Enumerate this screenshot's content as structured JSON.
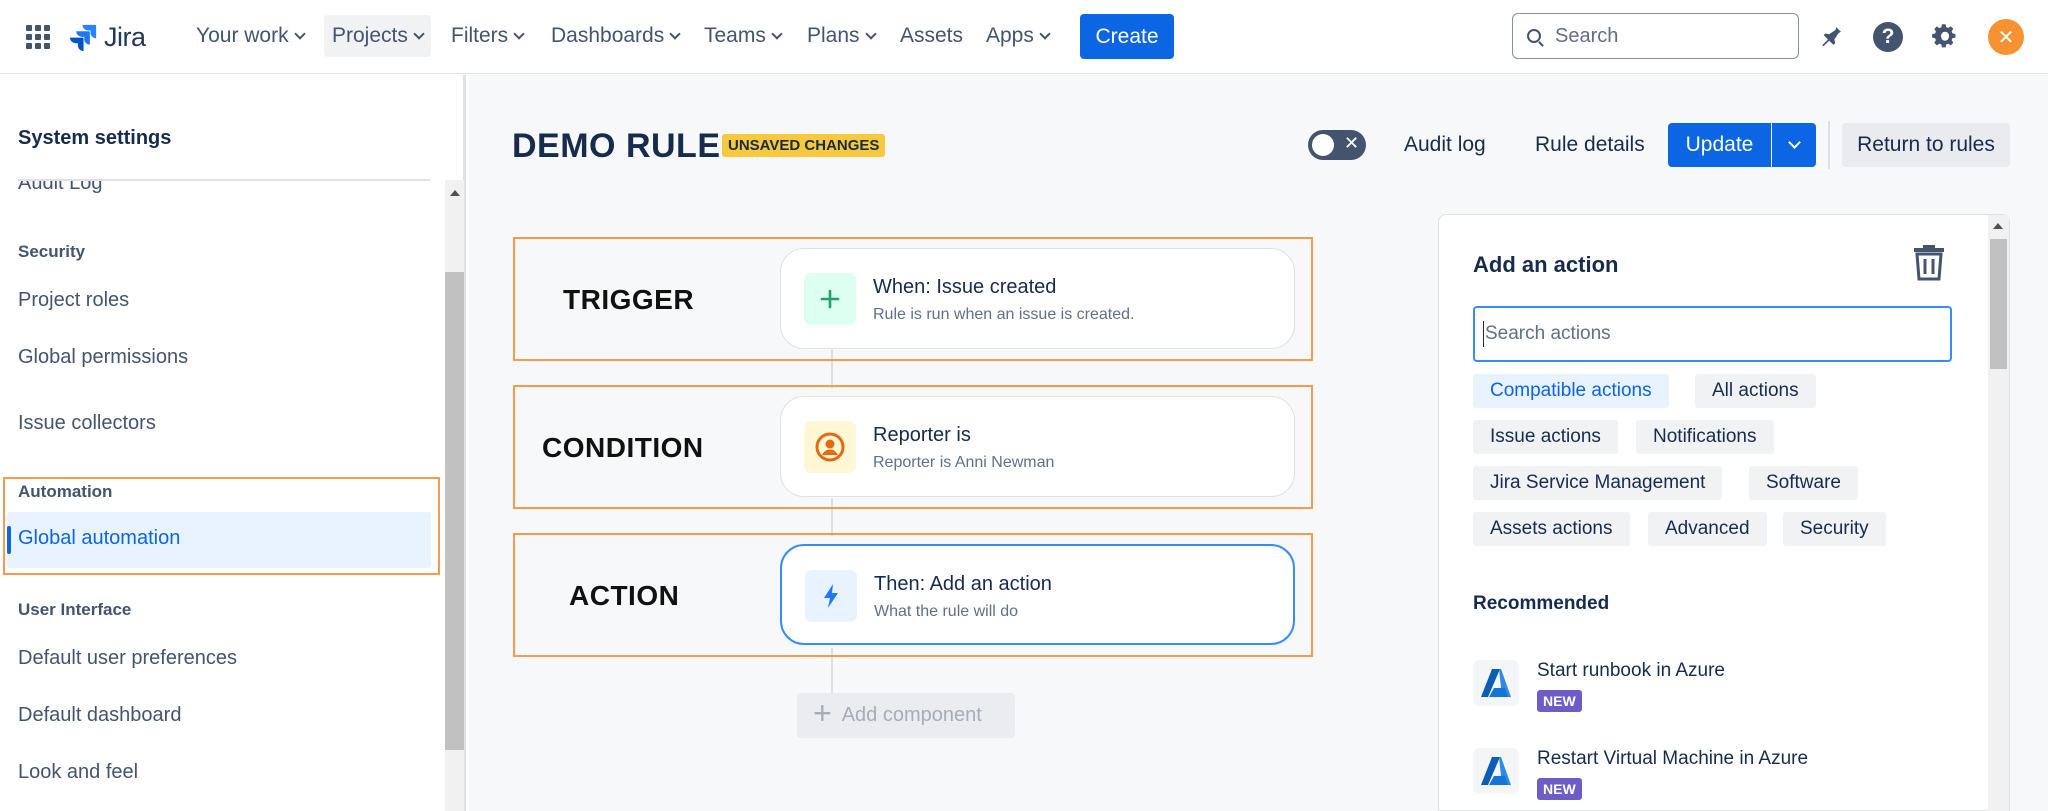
{
  "nav": {
    "brand": "Jira",
    "items": [
      "Your work",
      "Projects",
      "Filters",
      "Dashboards",
      "Teams",
      "Plans",
      "Assets",
      "Apps"
    ],
    "create_label": "Create",
    "search_placeholder": "Search"
  },
  "sidebar": {
    "title": "System settings",
    "partial_item": "Audit Log",
    "security_heading": "Security",
    "security_items": [
      "Project roles",
      "Global permissions",
      "Issue collectors"
    ],
    "automation_heading": "Automation",
    "automation_selected": "Global automation",
    "ui_heading": "User Interface",
    "ui_items": [
      "Default user preferences",
      "Default dashboard",
      "Look and feel"
    ]
  },
  "header": {
    "rule_title": "DEMO RULE",
    "unsaved_badge": "UNSAVED CHANGES",
    "toggle_symbol": "✕",
    "audit_log": "Audit log",
    "rule_details": "Rule details",
    "update_label": "Update",
    "return_label": "Return to rules"
  },
  "rule": {
    "labels": [
      "TRIGGER",
      "CONDITION",
      "ACTION"
    ],
    "trigger": {
      "title": "When: Issue created",
      "subtitle": "Rule is run when an issue is created.",
      "icon": "plus-icon"
    },
    "condition": {
      "title": "Reporter is",
      "subtitle": "Reporter is Anni Newman",
      "icon": "user-icon"
    },
    "action": {
      "title": "Then: Add an action",
      "subtitle": "What the rule will do",
      "icon": "lightning-icon"
    },
    "add_component": "Add component"
  },
  "panel": {
    "title": "Add an action",
    "search_placeholder": "Search actions",
    "chips": [
      "Compatible actions",
      "All actions",
      "Issue actions",
      "Notifications",
      "Jira Service Management",
      "Software",
      "Assets actions",
      "Advanced",
      "Security"
    ],
    "selected_chip": "Compatible actions",
    "recommended_title": "Recommended",
    "recommended": [
      {
        "name": "Start runbook in Azure",
        "badge": "NEW"
      },
      {
        "name": "Restart Virtual Machine in Azure",
        "badge": "NEW"
      }
    ]
  },
  "colors": {
    "primary": "#0c66e4",
    "annotation": "#f79a4d",
    "badge_warning": "#f8c83d",
    "badge_new": "#6e5dc6"
  }
}
